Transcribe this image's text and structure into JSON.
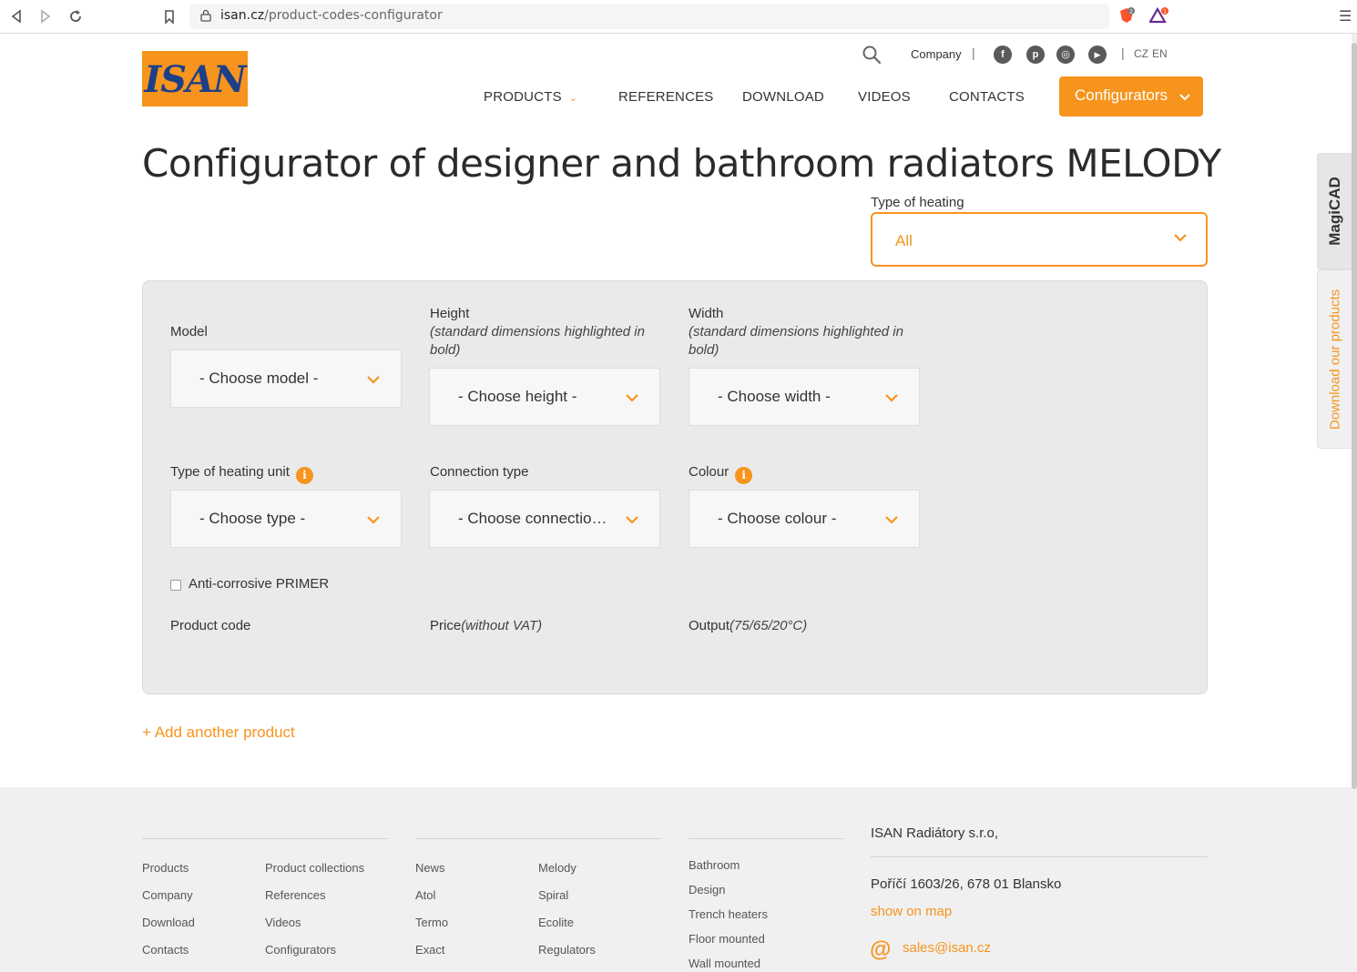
{
  "browser": {
    "url_domain": "isan.cz",
    "url_path": "/product-codes-configurator",
    "back_icon": "back-arrow-icon",
    "forward_icon": "forward-arrow-icon",
    "reload_icon": "reload-icon",
    "bookmark_icon": "bookmark-icon",
    "ext1_badge": "2",
    "ext2_badge": "1"
  },
  "header": {
    "logo_text": "ISAN",
    "top_links": {
      "company": "Company",
      "separator": "|",
      "lang_cz": "CZ",
      "lang_en": "EN"
    },
    "social": [
      "f",
      "p",
      "◎",
      "▶"
    ],
    "nav": [
      {
        "label": "PRODUCTS"
      },
      {
        "label": "REFERENCES"
      },
      {
        "label": "DOWNLOAD"
      },
      {
        "label": "VIDEOS"
      },
      {
        "label": "CONTACTS"
      }
    ],
    "configurators_label": "Configurators"
  },
  "side_tabs": {
    "magicad": "MagiCAD",
    "download": "Download our products"
  },
  "main": {
    "title": "Configurator of designer and bathroom radiators MELODY",
    "heating": {
      "label": "Type of heating",
      "value": "All"
    }
  },
  "panel": {
    "model": {
      "label": "Model",
      "value": "- Choose model -"
    },
    "height": {
      "label": "Height",
      "note": "(standard dimensions highlighted in bold)",
      "value": "- Choose height -"
    },
    "width": {
      "label": "Width",
      "note": "(standard dimensions highlighted in bold)",
      "value": "- Choose width -"
    },
    "unit_type": {
      "label": "Type of heating unit",
      "value": "- Choose type -"
    },
    "connection": {
      "label": "Connection type",
      "value": "- Choose connectio…"
    },
    "colour": {
      "label": "Colour",
      "value": "- Choose colour -"
    },
    "primer": {
      "label": "Anti-corrosive PRIMER",
      "checked": false
    },
    "product_code_label": "Product code",
    "price_label": "Price",
    "price_note": "(without VAT)",
    "output_label": "Output",
    "output_note": "(75/65/20°C)"
  },
  "add_another": "+ Add another product",
  "footer": {
    "col1": [
      "Products",
      "Company",
      "Download",
      "Contacts"
    ],
    "col2": [
      "Product collections",
      "References",
      "Videos",
      "Configurators"
    ],
    "col3": [
      "News",
      "Atol",
      "Termo",
      "Exact"
    ],
    "col4": [
      "Melody",
      "Spiral",
      "Ecolite",
      "Regulators"
    ],
    "col5": [
      "Bathroom",
      "Design",
      "Trench heaters",
      "Floor mounted",
      "Wall mounted"
    ],
    "company_name": "ISAN Radiátory s.r.o,",
    "address": "Poříčí 1603/26, 678 01 Blansko",
    "show_on_map": "show on map",
    "email": "sales@isan.cz"
  },
  "colors": {
    "accent": "#f7941d",
    "brand_blue": "#1d3f8a",
    "panel_bg": "#eaeaea"
  }
}
